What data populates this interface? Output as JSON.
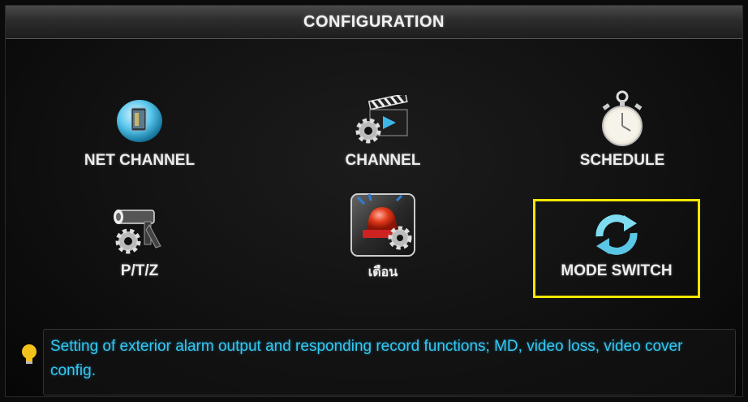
{
  "window": {
    "title": "CONFIGURATION"
  },
  "menu": {
    "items": [
      {
        "label": "NET CHANNEL",
        "icon": "net-channel-icon"
      },
      {
        "label": "CHANNEL",
        "icon": "clapperboard-gear-icon"
      },
      {
        "label": "SCHEDULE",
        "icon": "stopwatch-icon"
      },
      {
        "label": "P/T/Z",
        "icon": "camera-gear-icon"
      },
      {
        "label": "เตือน",
        "icon": "alarm-siren-icon"
      },
      {
        "label": "MODE SWITCH",
        "icon": "refresh-arrows-icon"
      }
    ],
    "highlighted": "MODE SWITCH"
  },
  "info": {
    "icon": "lightbulb-icon",
    "text": "Setting of exterior alarm output and responding record functions; MD, video loss, video cover config."
  },
  "colors": {
    "highlight": "#f2e600",
    "info_text": "#33c8f0",
    "label_text": "#ededed"
  }
}
